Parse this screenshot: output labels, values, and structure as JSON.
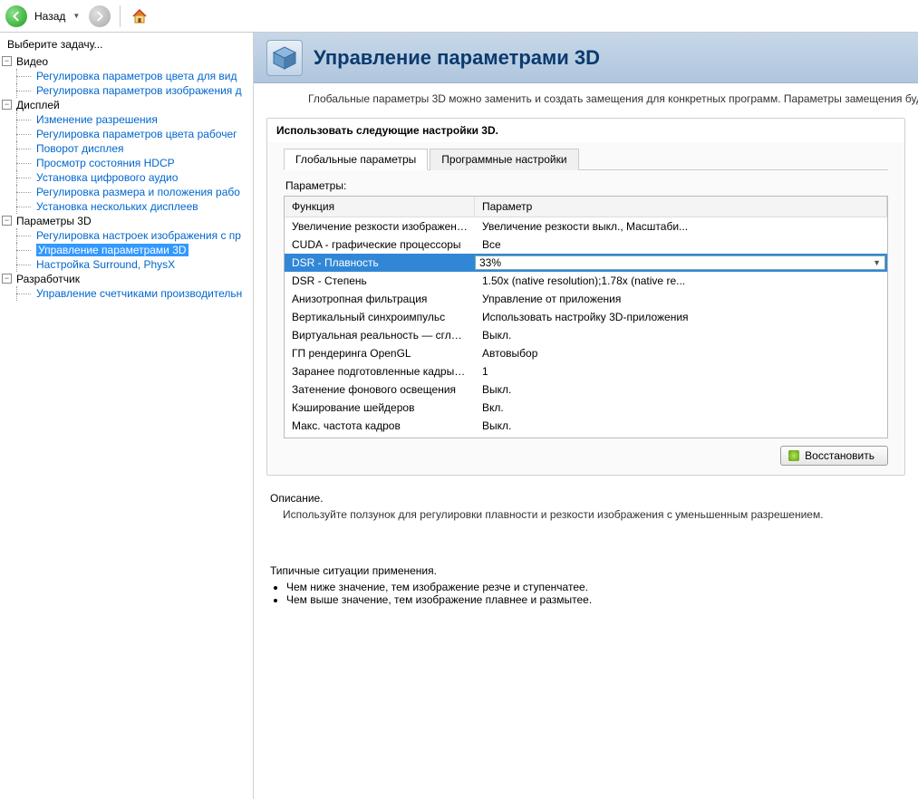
{
  "toolbar": {
    "back_label": "Назад"
  },
  "sidebar": {
    "task_label": "Выберите задачу...",
    "sections": [
      {
        "label": "Видео",
        "items": [
          "Регулировка параметров цвета для вид",
          "Регулировка параметров изображения д"
        ]
      },
      {
        "label": "Дисплей",
        "items": [
          "Изменение разрешения",
          "Регулировка параметров цвета рабочег",
          "Поворот дисплея",
          "Просмотр состояния HDCP",
          "Установка цифрового аудио",
          "Регулировка размера и положения рабо",
          "Установка нескольких дисплеев"
        ]
      },
      {
        "label": "Параметры 3D",
        "items": [
          "Регулировка настроек изображения с пр",
          "Управление параметрами 3D",
          "Настройка Surround, PhysX"
        ],
        "selected_index": 1
      },
      {
        "label": "Разработчик",
        "items": [
          "Управление счетчиками производительн"
        ]
      }
    ]
  },
  "header": {
    "title": "Управление параметрами 3D",
    "description": "Глобальные параметры 3D можно заменить и создать замещения для конкретных программ. Параметры замещения будут автоматич"
  },
  "group": {
    "title": "Использовать следующие настройки 3D.",
    "tabs": [
      "Глобальные параметры",
      "Программные настройки"
    ],
    "params_label": "Параметры:",
    "columns": [
      "Функция",
      "Параметр"
    ],
    "rows": [
      {
        "func": "Увеличение резкости изображения",
        "param": "Увеличение резкости выкл., Масштаби..."
      },
      {
        "func": "CUDA - графические процессоры",
        "param": "Все"
      },
      {
        "func": "DSR - Плавность",
        "param": "33%",
        "selected": true
      },
      {
        "func": "DSR - Степень",
        "param": "1.50x (native resolution);1.78x (native re..."
      },
      {
        "func": "Анизотропная фильтрация",
        "param": "Управление от приложения"
      },
      {
        "func": "Вертикальный синхроимпульс",
        "param": "Использовать настройку 3D-приложения"
      },
      {
        "func": "Виртуальная реальность — сглаживан...",
        "param": "Выкл."
      },
      {
        "func": "ГП рендеринга OpenGL",
        "param": "Автовыбор"
      },
      {
        "func": "Заранее подготовленные кадры вирту...",
        "param": "1"
      },
      {
        "func": "Затенение фонового освещения",
        "param": "Выкл."
      },
      {
        "func": "Кэширование шейдеров",
        "param": "Вкл."
      },
      {
        "func": "Макс. частота кадров",
        "param": "Выкл."
      }
    ],
    "restore_button": "Восстановить"
  },
  "description": {
    "title": "Описание.",
    "text": "Используйте ползунок для регулировки плавности и резкости изображения с уменьшенным разрешением."
  },
  "usage": {
    "title": "Типичные ситуации применения.",
    "items": [
      "Чем ниже значение, тем изображение резче и ступенчатее.",
      "Чем выше значение, тем изображение плавнее и размытее."
    ]
  }
}
